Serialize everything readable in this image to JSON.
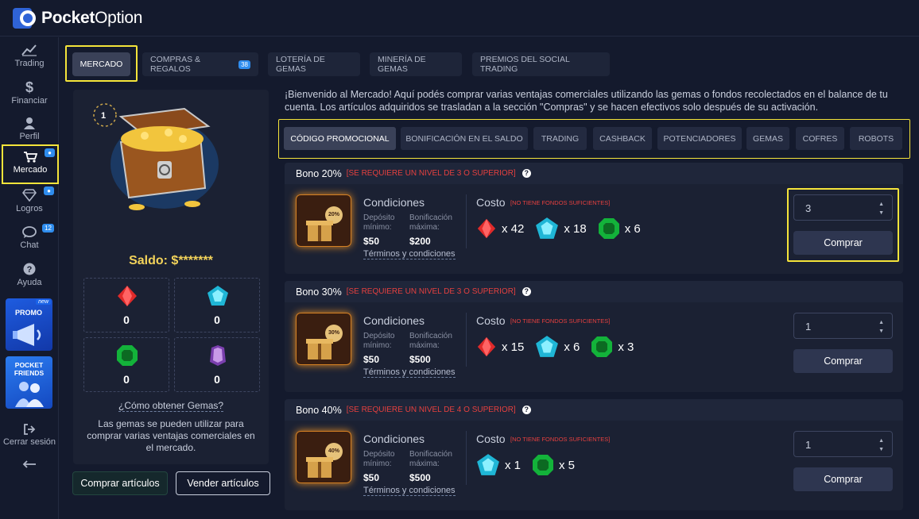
{
  "brand": {
    "name_bold": "Pocket",
    "name_regular": "Option"
  },
  "sidebar": {
    "items": [
      {
        "label": "Trading",
        "icon": "chart-line-icon"
      },
      {
        "label": "Financiar",
        "icon": "dollar-icon"
      },
      {
        "label": "Perfil",
        "icon": "user-icon"
      },
      {
        "label": "Mercado",
        "icon": "cart-icon",
        "badge": "bell"
      },
      {
        "label": "Logros",
        "icon": "diamond-icon",
        "badge": "bell"
      },
      {
        "label": "Chat",
        "icon": "chat-icon",
        "badge": "12"
      },
      {
        "label": "Ayuda",
        "icon": "help-icon"
      }
    ],
    "promo": {
      "label": "PROMO",
      "tag": "new"
    },
    "friends": {
      "label": "POCKET FRIENDS"
    },
    "logout": "Cerrar sesión"
  },
  "top_tabs": [
    {
      "label": "MERCADO",
      "active": true
    },
    {
      "label": "COMPRAS & REGALOS",
      "badge": "38"
    },
    {
      "label": "LOTERÍA DE GEMAS"
    },
    {
      "label": "MINERÍA DE GEMAS"
    },
    {
      "label": "PREMIOS DEL SOCIAL TRADING"
    }
  ],
  "left_panel": {
    "level": "1",
    "balance": "Saldo: $*******",
    "gems": [
      {
        "name": "red-gem",
        "count": "0"
      },
      {
        "name": "blue-gem",
        "count": "0"
      },
      {
        "name": "green-gem",
        "count": "0"
      },
      {
        "name": "purple-gem",
        "count": "0"
      }
    ],
    "how_to": "¿Cómo obtener Gemas?",
    "description": "Las gemas se pueden utilizar para comprar varias ventajas comerciales en el mercado.",
    "buy_btn": "Comprar artículos",
    "sell_btn": "Vender artículos"
  },
  "intro": "¡Bienvenido al Mercado! Aquí podés comprar varias ventajas comerciales utilizando las gemas o fondos recolectados en el balance de tu cuenta. Los artículos adquiridos se trasladan a la sección \"Compras\" y se hacen efectivos solo después de su activación.",
  "categories": [
    {
      "label": "CÓDIGO PROMOCIONAL",
      "active": true
    },
    {
      "label": "BONIFICACIÓN EN EL SALDO"
    },
    {
      "label": "TRADING"
    },
    {
      "label": "CASHBACK"
    },
    {
      "label": "POTENCIADORES"
    },
    {
      "label": "GEMAS"
    },
    {
      "label": "COFRES"
    },
    {
      "label": "ROBOTS"
    }
  ],
  "offer_labels": {
    "conditions": "Condiciones",
    "deposit_min": "Depósito mínimo:",
    "bonus_max": "Bonificación máxima:",
    "terms": "Términos y condiciones",
    "cost": "Costo",
    "no_funds": "[NO TIENE FONDOS SUFICIENTES]",
    "buy": "Comprar"
  },
  "offers": [
    {
      "title": "Bono 20%",
      "requirement": "[SE REQUIERE UN NIVEL DE 3 O SUPERIOR]",
      "badge": "20%",
      "deposit": "$50",
      "bonus": "$200",
      "cost": [
        {
          "gem": "red",
          "qty": "x 42"
        },
        {
          "gem": "blue",
          "qty": "x 18"
        },
        {
          "gem": "green",
          "qty": "x 6"
        }
      ],
      "quantity": "3"
    },
    {
      "title": "Bono 30%",
      "requirement": "[SE REQUIERE UN NIVEL DE 3 O SUPERIOR]",
      "badge": "30%",
      "deposit": "$50",
      "bonus": "$500",
      "cost": [
        {
          "gem": "red",
          "qty": "x 15"
        },
        {
          "gem": "blue",
          "qty": "x 6"
        },
        {
          "gem": "green",
          "qty": "x 3"
        }
      ],
      "quantity": "1"
    },
    {
      "title": "Bono 40%",
      "requirement": "[SE REQUIERE UN NIVEL DE 4 O SUPERIOR]",
      "badge": "40%",
      "deposit": "$50",
      "bonus": "$500",
      "cost": [
        {
          "gem": "blue",
          "qty": "x 1"
        },
        {
          "gem": "green",
          "qty": "x 5"
        }
      ],
      "quantity": "1"
    }
  ],
  "colors": {
    "accent": "#2f8dee",
    "highlight": "#f5e43a",
    "warning": "#e5403f",
    "balance": "#f3d35a"
  }
}
